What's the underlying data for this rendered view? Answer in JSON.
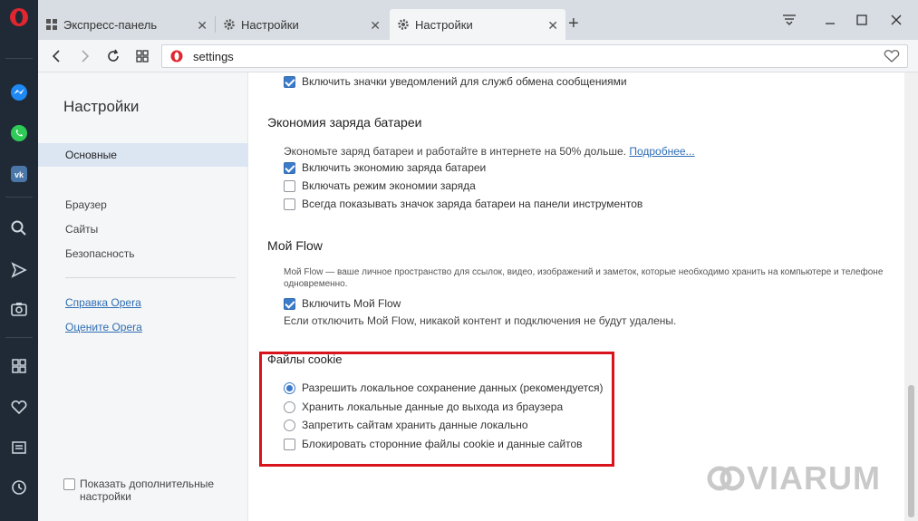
{
  "tabs": [
    {
      "label": "Экспресс-панель",
      "active": false
    },
    {
      "label": "Настройки",
      "active": false
    },
    {
      "label": "Настройки",
      "active": true
    }
  ],
  "address": {
    "url": "settings"
  },
  "settings_nav": {
    "title": "Настройки",
    "items": [
      "Основные",
      "Браузер",
      "Сайты",
      "Безопасность"
    ],
    "selected": "Основные",
    "links": [
      "Справка Opera",
      "Оцените Opera"
    ],
    "advanced_label": "Показать дополнительные настройки"
  },
  "notifications": {
    "checkbox_label": "Включить значки уведомлений для служб обмена сообщениями"
  },
  "battery": {
    "title": "Экономия заряда батареи",
    "description": "Экономьте заряд батареи и работайте в интернете на 50% дольше.",
    "more_link": "Подробнее...",
    "options": [
      {
        "label": "Включить экономию заряда батареи",
        "checked": true
      },
      {
        "label": "Включать режим экономии заряда",
        "checked": false
      },
      {
        "label": "Всегда показывать значок заряда батареи на панели инструментов",
        "checked": false
      }
    ]
  },
  "flow": {
    "title": "Мой Flow",
    "description_line1": "Мой Flow — ваше личное пространство для ссылок, видео, изображений и заметок, которые необходимо хранить на компьютере и телефоне",
    "description_line2": "одновременно.",
    "enable_label": "Включить Мой Flow",
    "note": "Если отключить Мой Flow, никакой контент и подключения не будут удалены."
  },
  "cookies": {
    "title": "Файлы cookie",
    "radio_options": [
      {
        "label": "Разрешить локальное сохранение данных (рекомендуется)",
        "selected": true
      },
      {
        "label": "Хранить локальные данные до выхода из браузера",
        "selected": false
      },
      {
        "label": "Запретить сайтам хранить данные локально",
        "selected": false
      }
    ],
    "block_third_party_label": "Блокировать сторонние файлы cookie и данные сайтов",
    "block_third_party_checked": false
  },
  "watermark": {
    "text": "VIARUM"
  },
  "colors": {
    "accent": "#3b7bc8",
    "highlight": "#d9131b",
    "sidebar": "#1f2a36",
    "link": "#2e6db4"
  },
  "icons": [
    "opera-logo-icon",
    "messenger-icon",
    "whatsapp-icon",
    "vk-icon",
    "search-icon",
    "send-icon",
    "camera-icon",
    "grid-icon",
    "heart-icon",
    "news-icon",
    "history-icon"
  ]
}
